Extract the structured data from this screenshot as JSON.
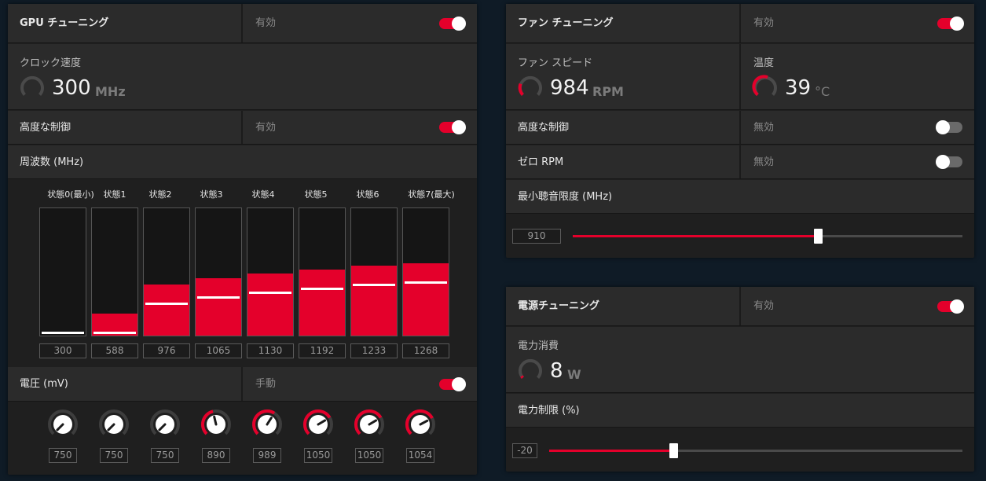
{
  "gpu": {
    "title": "GPU チューニング",
    "status": "有効",
    "clock_label": "クロック速度",
    "clock_value": "300",
    "clock_unit": "MHz",
    "advanced_label": "高度な制御",
    "advanced_status": "有効",
    "freq_title": "周波数 (MHz)",
    "states": [
      {
        "label": "状態0(最小)",
        "value": "300",
        "level": 0.0
      },
      {
        "label": "状態1",
        "value": "588",
        "level": 0.17
      },
      {
        "label": "状態2",
        "value": "976",
        "level": 0.4
      },
      {
        "label": "状態3",
        "value": "1065",
        "level": 0.45
      },
      {
        "label": "状態4",
        "value": "1130",
        "level": 0.49
      },
      {
        "label": "状態5",
        "value": "1192",
        "level": 0.52
      },
      {
        "label": "状態6",
        "value": "1233",
        "level": 0.55
      },
      {
        "label": "状態7(最大)",
        "value": "1268",
        "level": 0.57
      }
    ],
    "voltage_title": "電圧 (mV)",
    "voltage_status": "手動",
    "voltages": [
      {
        "value": "750",
        "level": 0.0
      },
      {
        "value": "750",
        "level": 0.0
      },
      {
        "value": "750",
        "level": 0.0
      },
      {
        "value": "890",
        "level": 0.45
      },
      {
        "value": "989",
        "level": 0.62
      },
      {
        "value": "1050",
        "level": 0.72
      },
      {
        "value": "1050",
        "level": 0.72
      },
      {
        "value": "1054",
        "level": 0.73
      }
    ]
  },
  "fan": {
    "title": "ファン チューニング",
    "status": "有効",
    "speed_label": "ファン スピード",
    "speed_value": "984",
    "speed_unit": "RPM",
    "temp_label": "温度",
    "temp_value": "39",
    "temp_unit": "°C",
    "advanced_label": "高度な制御",
    "advanced_status": "無効",
    "zero_rpm_label": "ゼロ RPM",
    "zero_rpm_status": "無効",
    "min_acoustic_label": "最小聴音限度 (MHz)",
    "min_acoustic_value": "910",
    "min_acoustic_level": 0.63
  },
  "power": {
    "title": "電源チューニング",
    "status": "有効",
    "consumption_label": "電力消費",
    "consumption_value": "8",
    "consumption_unit": "W",
    "limit_label": "電力制限 (%)",
    "limit_value": "-20",
    "limit_level": 0.3
  },
  "colors": {
    "accent": "#e4002b",
    "panel": "#1f1f1f",
    "row": "#2b2b2b",
    "background": "#0f1b26"
  },
  "icons": [
    "gauge-icon",
    "toggle-switch",
    "dial-knob"
  ]
}
